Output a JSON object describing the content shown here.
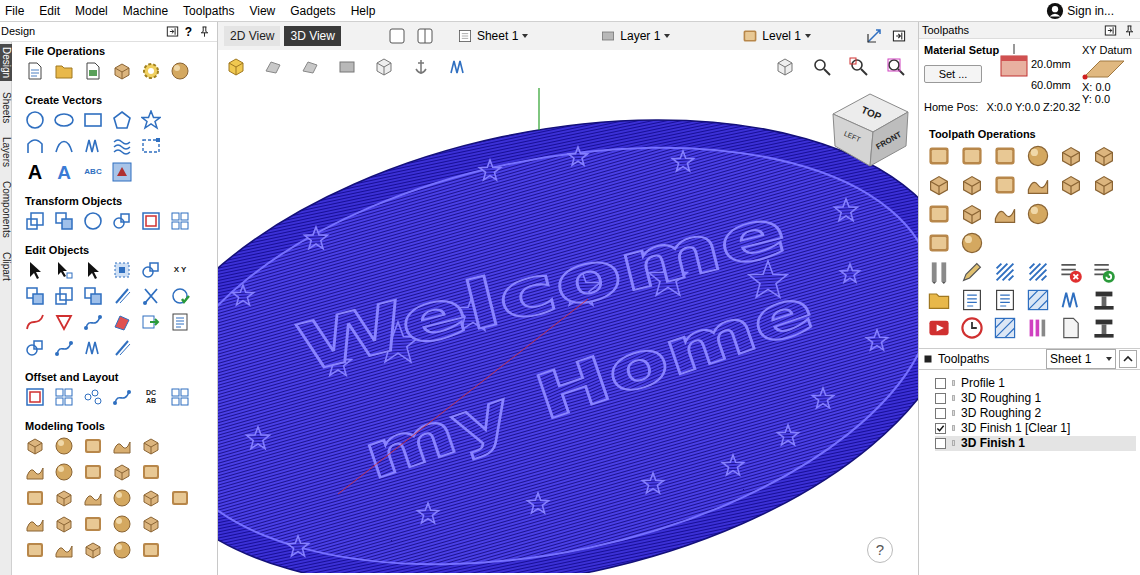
{
  "menu": [
    "File",
    "Edit",
    "Model",
    "Machine",
    "Toolpaths",
    "View",
    "Gadgets",
    "Help"
  ],
  "account": {
    "label": "Sign in..."
  },
  "design_panel": {
    "title": "Design",
    "help": "?",
    "side_tabs": [
      {
        "label": "Design",
        "selected": true
      },
      {
        "label": "Sheets",
        "selected": false
      },
      {
        "label": "Layers",
        "selected": false
      },
      {
        "label": "Components",
        "selected": false
      },
      {
        "label": "Clipart",
        "selected": false
      }
    ],
    "sections": [
      {
        "title": "File Operations",
        "glyphs": []
      },
      {
        "title": "Create Vectors",
        "glyphs": [
          "A",
          "A",
          "ABC"
        ]
      },
      {
        "title": "Transform Objects",
        "glyphs": []
      },
      {
        "title": "Edit Objects",
        "glyphs": [
          "X Y"
        ]
      },
      {
        "title": "Offset and Layout",
        "glyphs": [
          "DC AB"
        ]
      },
      {
        "title": "Modeling Tools",
        "glyphs": []
      }
    ]
  },
  "view": {
    "tabs": [
      {
        "label": "2D View",
        "selected": false
      },
      {
        "label": "3D View",
        "selected": true
      }
    ],
    "sheet": "Sheet 1",
    "layer": "Layer 1",
    "level": "Level 1",
    "model_text": [
      "Welcome",
      "my Home"
    ],
    "view_cube": [
      "TOP",
      "LEFT",
      "FRONT"
    ],
    "help": "?"
  },
  "toolpaths_panel": {
    "title": "Toolpaths",
    "material_setup": "Material Setup",
    "set_button": "Set ...",
    "thickness": "20.0mm",
    "size": "60.0mm",
    "datum_label": "XY Datum",
    "datum_x": "X: 0.0",
    "datum_y": "Y: 0.0",
    "home_label": "Home Pos:",
    "home_value": "X:0.0 Y:0.0 Z:20.32",
    "operations_title": "Toolpath Operations",
    "list_title": "Toolpaths",
    "sheet": "Sheet 1",
    "items": [
      {
        "label": "Profile 1",
        "checked": false,
        "selected": false
      },
      {
        "label": "3D Roughing 1",
        "checked": false,
        "selected": false
      },
      {
        "label": "3D Roughing 2",
        "checked": false,
        "selected": false
      },
      {
        "label": "3D Finish 1 [Clear 1]",
        "checked": true,
        "selected": false
      },
      {
        "label": "3D Finish 1",
        "checked": false,
        "selected": true
      }
    ]
  }
}
